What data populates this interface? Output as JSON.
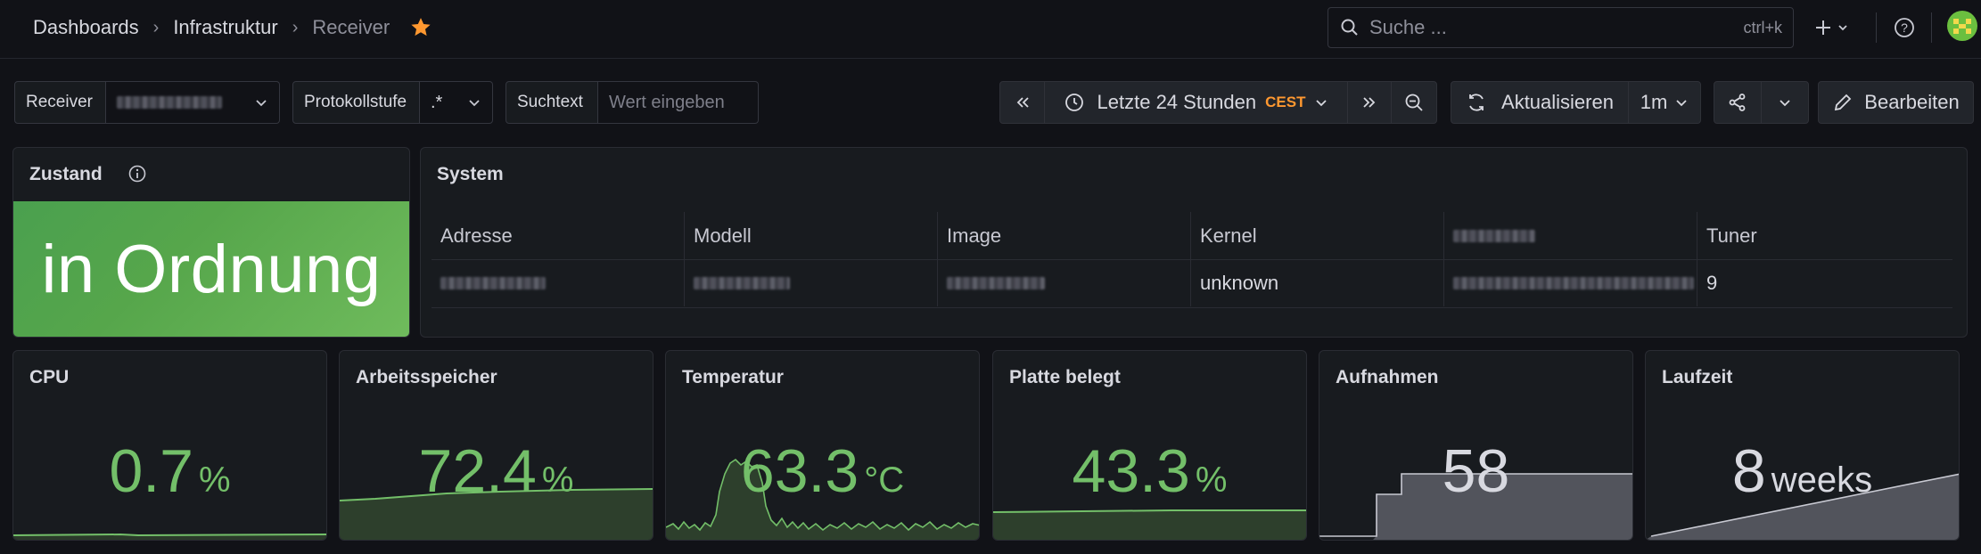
{
  "breadcrumb": {
    "items": [
      "Dashboards",
      "Infrastruktur",
      "Receiver"
    ]
  },
  "search": {
    "placeholder": "Suche ...",
    "shortcut": "ctrl+k"
  },
  "variables": {
    "receiver_label": "Receiver",
    "protokoll_label": "Protokollstufe",
    "protokoll_value": ".*",
    "suchtext_label": "Suchtext",
    "suchtext_placeholder": "Wert eingeben"
  },
  "toolbar": {
    "time_range": "Letzte 24 Stunden",
    "timezone": "CEST",
    "refresh_label": "Aktualisieren",
    "refresh_interval": "1m",
    "edit_label": "Bearbeiten"
  },
  "panels": {
    "zustand": {
      "title": "Zustand",
      "value": "in Ordnung",
      "color": "#56a64b"
    },
    "system": {
      "title": "System",
      "columns": [
        "Adresse",
        "Modell",
        "Image",
        "Kernel",
        "",
        "Tuner"
      ],
      "row": [
        "",
        "",
        "",
        "unknown",
        "",
        "9"
      ]
    },
    "cpu": {
      "title": "CPU",
      "value": "0.7",
      "unit": "%"
    },
    "ram": {
      "title": "Arbeitsspeicher",
      "value": "72.4",
      "unit": "%"
    },
    "temp": {
      "title": "Temperatur",
      "value": "63.3",
      "unit": "°C"
    },
    "disk": {
      "title": "Platte belegt",
      "value": "43.3",
      "unit": "%"
    },
    "rec": {
      "title": "Aufnahmen",
      "value": "58"
    },
    "uptime": {
      "title": "Laufzeit",
      "value": "8",
      "unit": "weeks"
    }
  },
  "colors": {
    "green": "#73bf69",
    "accent": "#ff9830",
    "background": "#111217"
  }
}
